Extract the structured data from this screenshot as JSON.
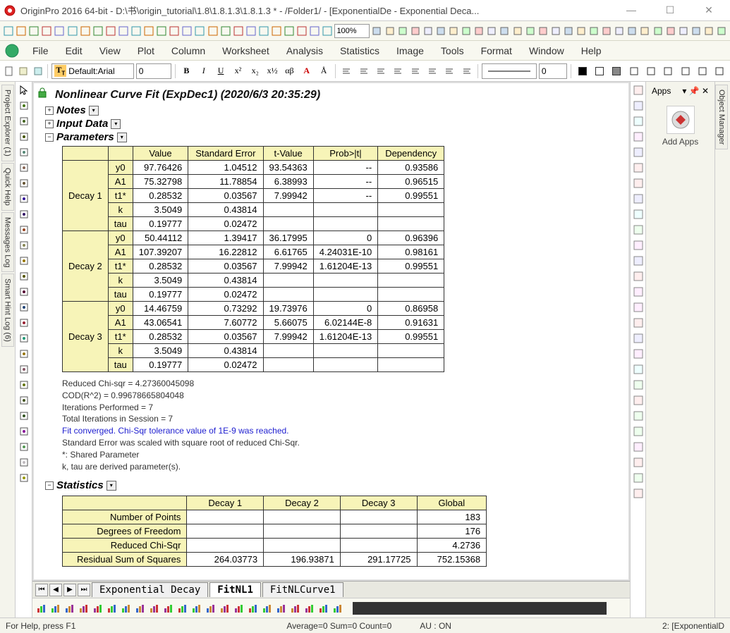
{
  "window": {
    "title": "OriginPro 2016 64-bit - D:\\书\\origin_tutorial\\1.8\\1.8.1.3\\1.8.1.3 * - /Folder1/ - [ExponentialDe - Exponential Deca..."
  },
  "menu": [
    "File",
    "Edit",
    "View",
    "Plot",
    "Column",
    "Worksheet",
    "Analysis",
    "Statistics",
    "Image",
    "Tools",
    "Format",
    "Window",
    "Help"
  ],
  "format_bar": {
    "font_label_prefix": "Default: ",
    "font_name": "Arial",
    "font_size": "0",
    "line_weight": "0"
  },
  "zoom": "100%",
  "left_dock_tabs": [
    "Project Explorer (1)",
    "Quick Help",
    "Messages Log",
    "Smart Hint Log (6)"
  ],
  "right_dock_tab": "Object Manager",
  "apps_panel": {
    "title": "Apps",
    "add_label": "Add Apps"
  },
  "report": {
    "title": "Nonlinear Curve Fit (ExpDec1) (2020/6/3 20:35:29)",
    "sections": {
      "notes": "Notes",
      "input": "Input Data",
      "parameters": "Parameters",
      "statistics": "Statistics"
    },
    "param_headers": [
      "",
      "",
      "Value",
      "Standard Error",
      "t-Value",
      "Prob>|t|",
      "Dependency"
    ],
    "param_groups": [
      {
        "name": "Decay 1",
        "rows": [
          {
            "p": "y0",
            "v": "97.76426",
            "se": "1.04512",
            "t": "93.54363",
            "pr": "--",
            "dep": "0.93586"
          },
          {
            "p": "A1",
            "v": "75.32798",
            "se": "11.78854",
            "t": "6.38993",
            "pr": "--",
            "dep": "0.96515"
          },
          {
            "p": "t1*",
            "v": "0.28532",
            "se": "0.03567",
            "t": "7.99942",
            "pr": "--",
            "dep": "0.99551"
          },
          {
            "p": "k",
            "v": "3.5049",
            "se": "0.43814",
            "t": "",
            "pr": "",
            "dep": ""
          },
          {
            "p": "tau",
            "v": "0.19777",
            "se": "0.02472",
            "t": "",
            "pr": "",
            "dep": ""
          }
        ]
      },
      {
        "name": "Decay 2",
        "rows": [
          {
            "p": "y0",
            "v": "50.44112",
            "se": "1.39417",
            "t": "36.17995",
            "pr": "0",
            "dep": "0.96396"
          },
          {
            "p": "A1",
            "v": "107.39207",
            "se": "16.22812",
            "t": "6.61765",
            "pr": "4.24031E-10",
            "dep": "0.98161"
          },
          {
            "p": "t1*",
            "v": "0.28532",
            "se": "0.03567",
            "t": "7.99942",
            "pr": "1.61204E-13",
            "dep": "0.99551"
          },
          {
            "p": "k",
            "v": "3.5049",
            "se": "0.43814",
            "t": "",
            "pr": "",
            "dep": ""
          },
          {
            "p": "tau",
            "v": "0.19777",
            "se": "0.02472",
            "t": "",
            "pr": "",
            "dep": ""
          }
        ]
      },
      {
        "name": "Decay 3",
        "rows": [
          {
            "p": "y0",
            "v": "14.46759",
            "se": "0.73292",
            "t": "19.73976",
            "pr": "0",
            "dep": "0.86958"
          },
          {
            "p": "A1",
            "v": "43.06541",
            "se": "7.60772",
            "t": "5.66075",
            "pr": "6.02144E-8",
            "dep": "0.91631"
          },
          {
            "p": "t1*",
            "v": "0.28532",
            "se": "0.03567",
            "t": "7.99942",
            "pr": "1.61204E-13",
            "dep": "0.99551"
          },
          {
            "p": "k",
            "v": "3.5049",
            "se": "0.43814",
            "t": "",
            "pr": "",
            "dep": ""
          },
          {
            "p": "tau",
            "v": "0.19777",
            "se": "0.02472",
            "t": "",
            "pr": "",
            "dep": ""
          }
        ]
      }
    ],
    "notes_lines": [
      "Reduced Chi-sqr = 4.27360045098",
      "COD(R^2) = 0.99678665804048",
      "Iterations Performed = 7",
      "Total Iterations in Session = 7"
    ],
    "blue_line": "Fit converged. Chi-Sqr tolerance value of 1E-9 was reached.",
    "notes_lines2": [
      "Standard Error was scaled with square root of reduced Chi-Sqr.",
      "*: Shared Parameter",
      "k, tau are derived parameter(s)."
    ],
    "stats_headers": [
      "",
      "Decay 1",
      "Decay 2",
      "Decay 3",
      "Global"
    ],
    "stats_rows": [
      {
        "lbl": "Number of Points",
        "v": [
          "",
          "",
          "",
          "183"
        ]
      },
      {
        "lbl": "Degrees of Freedom",
        "v": [
          "",
          "",
          "",
          "176"
        ]
      },
      {
        "lbl": "Reduced Chi-Sqr",
        "v": [
          "",
          "",
          "",
          "4.2736"
        ]
      },
      {
        "lbl": "Residual Sum of Squares",
        "v": [
          "264.03773",
          "196.93871",
          "291.17725",
          "752.15368"
        ]
      }
    ]
  },
  "sheet_tabs": [
    "Exponential Decay",
    "FitNL1",
    "FitNLCurve1"
  ],
  "status": {
    "help": "For Help, press F1",
    "avg": "Average=0 Sum=0 Count=0",
    "au": "AU : ON",
    "right": "2: [ExponentialD"
  }
}
